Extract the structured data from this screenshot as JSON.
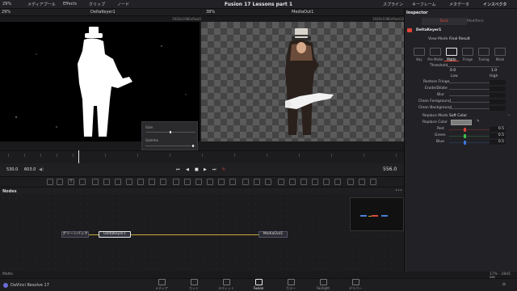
{
  "topbar": {
    "zoom_left": "29%",
    "media_pool": "メディアプール",
    "effects": "Effects",
    "clips": "クリップ",
    "nodes": "ノード",
    "title": "Fusion 17  Lessons part 1",
    "spline": "スプライン",
    "keyframes": "キーフレーム",
    "metadata": "メタデータ",
    "inspector": "インスペクタ",
    "zoom_right": "38%"
  },
  "viewer_left": {
    "node_name": "DeltaKeyer1",
    "format": "1920x1080xfloat32",
    "gain_label": "Gain",
    "gamma_label": "Gamma"
  },
  "viewer_right": {
    "node_name": "MediaOut1",
    "format": "1920x1080xfloat32"
  },
  "transport": {
    "start": "530.0",
    "end": "603.0",
    "current": "556.0"
  },
  "nodes_panel": {
    "header": "Nodes",
    "node_green": "グリーンバック",
    "node_keyer": "DeltaKeyer1",
    "node_out": "MediaOut1"
  },
  "inspector": {
    "title": "Inspector",
    "tab_tools": "Tools",
    "tab_modifiers": "Modifiers",
    "node_name": "DeltaKeyer1",
    "view_mode_label": "View Mode",
    "view_mode_value": "Final Result",
    "subtabs": [
      "Key",
      "Pre Matte",
      "Matte",
      "Fringe",
      "Tuning",
      "Mask"
    ],
    "threshold_label": "Threshold",
    "threshold_low": "0.0",
    "threshold_high": "1.0",
    "low_label": "Low",
    "high_label": "High",
    "restore_fringe": "Restore Fringe",
    "erode_dilate": "Erode/Dilate",
    "blur": "Blur",
    "clean_foreground": "Clean Foreground",
    "clean_background": "Clean Background",
    "replace_mode_label": "Replace Mode",
    "replace_mode_value": "Soft Color",
    "replace_color_label": "Replace Color",
    "red_label": "Red",
    "red_value": "0.5",
    "green_label": "Green",
    "green_value": "0.5",
    "blue_label": "Blue",
    "blue_value": "0.5"
  },
  "status": {
    "left": "Matte",
    "right": "17% - 2845 MB"
  },
  "bottom_nav": {
    "app_name": "DaVinci Resolve 17",
    "pages": [
      "メディア",
      "カット",
      "エディット",
      "Fusion",
      "カラー",
      "Fairlight",
      "デリバー"
    ],
    "active": "Fusion"
  },
  "colors": {
    "accent_red": "#e0453a",
    "slider_red": "#d8463c",
    "slider_green": "#3cc24e",
    "slider_blue": "#3c76e0",
    "connection_yellow": "#c9a93a"
  }
}
